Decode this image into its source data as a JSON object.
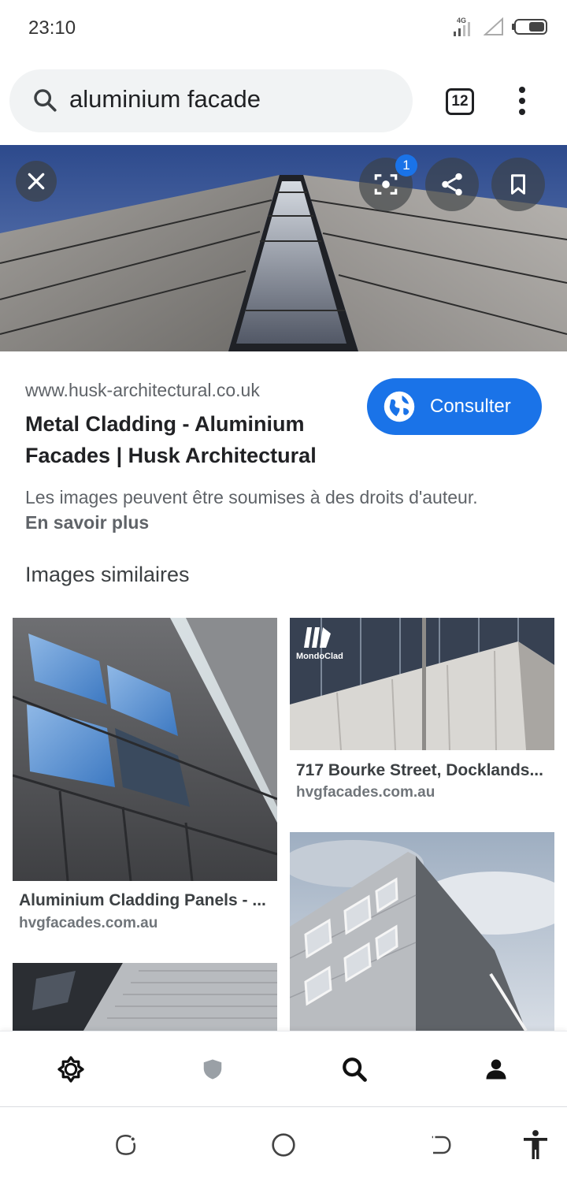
{
  "status_bar": {
    "time": "23:10",
    "network": "4G"
  },
  "search": {
    "query": "aluminium facade",
    "tab_count": "12"
  },
  "lens": {
    "badge": "1"
  },
  "result": {
    "url": "www.husk-architectural.co.uk",
    "title_line1": "Metal Cladding - Aluminium",
    "title_line2": "Facades | Husk Architectural",
    "visit_label": "Consulter",
    "copyright": "Les images peuvent être soumises à des droits d'auteur.",
    "learn_more": "En savoir plus"
  },
  "similar": {
    "heading": "Images similaires",
    "items": [
      {
        "title": "Aluminium Cladding Panels - ...",
        "domain": "hvgfacades.com.au"
      },
      {
        "title": "717 Bourke Street, Docklands...",
        "domain": "hvgfacades.com.au",
        "logo_text": "MondoClad"
      }
    ]
  },
  "bottom_nav": {
    "items": [
      {
        "icon": "discover-icon"
      },
      {
        "icon": "shield-icon"
      },
      {
        "icon": "search-icon"
      },
      {
        "icon": "account-icon"
      }
    ]
  },
  "colors": {
    "accent": "#1a73e8",
    "pill_bg": "#f1f3f4",
    "text": "#202124",
    "muted": "#5f6368"
  }
}
